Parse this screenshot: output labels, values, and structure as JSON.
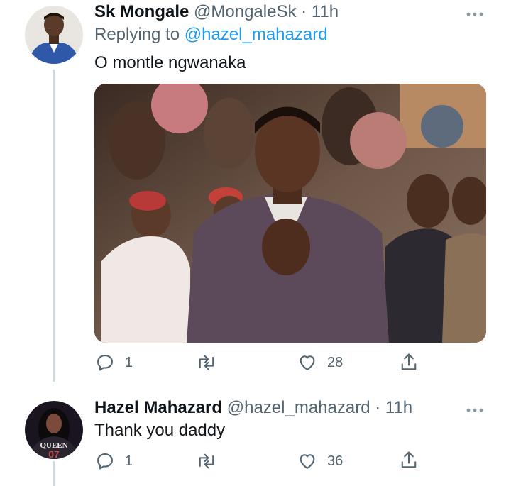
{
  "tweets": [
    {
      "name": "Sk Mongale",
      "handle": "@MongaleSk",
      "sep": "·",
      "time": "11h",
      "replying_prefix": "Replying to",
      "replying_to": "@hazel_mahazard",
      "text": "O montle ngwanaka",
      "replies": "1",
      "likes": "28",
      "more_icon": "more-horizontal-icon"
    },
    {
      "name": "Hazel Mahazard",
      "handle": "@hazel_mahazard",
      "sep": "·",
      "time": "11h",
      "text": "Thank you daddy",
      "replies": "1",
      "likes": "36",
      "avatar_text": "QUEEN",
      "more_icon": "more-horizontal-icon"
    }
  ],
  "icons": [
    "reply-icon",
    "retweet-icon",
    "like-icon",
    "share-icon"
  ],
  "colors": {
    "link": "#1d9bf0",
    "muted": "#536471",
    "line": "#cfd9de"
  }
}
